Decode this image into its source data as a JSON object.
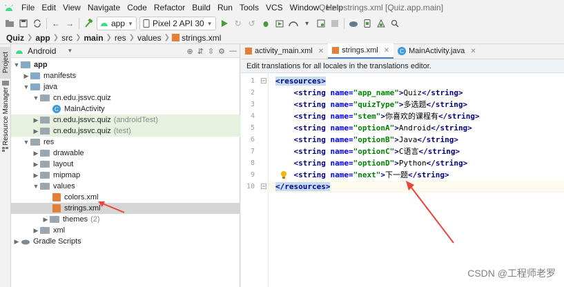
{
  "menu": {
    "items": [
      "File",
      "Edit",
      "View",
      "Navigate",
      "Code",
      "Refactor",
      "Build",
      "Run",
      "Tools",
      "VCS",
      "Window",
      "Help"
    ],
    "window_title": "Quiz - strings.xml [Quiz.app.main]"
  },
  "toolbar": {
    "module": "app",
    "device": "Pixel 2 API 30"
  },
  "breadcrumb": [
    "Quiz",
    "app",
    "src",
    "main",
    "res",
    "values",
    "strings.xml"
  ],
  "side_tabs": {
    "project": "Project",
    "resource_manager": "Resource Manager"
  },
  "project_panel": {
    "view_mode": "Android",
    "tree": [
      {
        "label": "app",
        "extra": ""
      },
      {
        "label": "manifests",
        "extra": ""
      },
      {
        "label": "java",
        "extra": ""
      },
      {
        "label": "cn.edu.jssvc.quiz",
        "extra": ""
      },
      {
        "label": "MainActivity",
        "extra": ""
      },
      {
        "label": "cn.edu.jssvc.quiz",
        "extra": "(androidTest)"
      },
      {
        "label": "cn.edu.jssvc.quiz",
        "extra": "(test)"
      },
      {
        "label": "res",
        "extra": ""
      },
      {
        "label": "drawable",
        "extra": ""
      },
      {
        "label": "layout",
        "extra": ""
      },
      {
        "label": "mipmap",
        "extra": ""
      },
      {
        "label": "values",
        "extra": ""
      },
      {
        "label": "colors.xml",
        "extra": ""
      },
      {
        "label": "strings.xml",
        "extra": ""
      },
      {
        "label": "themes",
        "extra": "(2)"
      },
      {
        "label": "xml",
        "extra": ""
      },
      {
        "label": "Gradle Scripts",
        "extra": ""
      }
    ]
  },
  "editor": {
    "tabs": [
      "activity_main.xml",
      "strings.xml",
      "MainActivity.java"
    ],
    "active_tab": "strings.xml",
    "banner": "Edit translations for all locales in the translations editor.",
    "line_numbers": [
      "1",
      "2",
      "3",
      "4",
      "5",
      "6",
      "7",
      "8",
      "9",
      "10"
    ],
    "root_open": "<resources>",
    "root_close": "</resources>",
    "strings": [
      {
        "name": "app_name",
        "value": "Quiz"
      },
      {
        "name": "quizType",
        "value": "多选题"
      },
      {
        "name": "stem",
        "value": "你喜欢的课程有"
      },
      {
        "name": "optionA",
        "value": "Android"
      },
      {
        "name": "optionB",
        "value": "Java"
      },
      {
        "name": "optionC",
        "value": "C语言"
      },
      {
        "name": "optionD",
        "value": "Python"
      },
      {
        "name": "next",
        "value": "下一题"
      }
    ]
  },
  "watermark": "CSDN @工程师老罗",
  "colors": {
    "annotation_arrow": "#e8453c",
    "tag": "#000080",
    "attr": "#0000ff",
    "value": "#008000"
  }
}
